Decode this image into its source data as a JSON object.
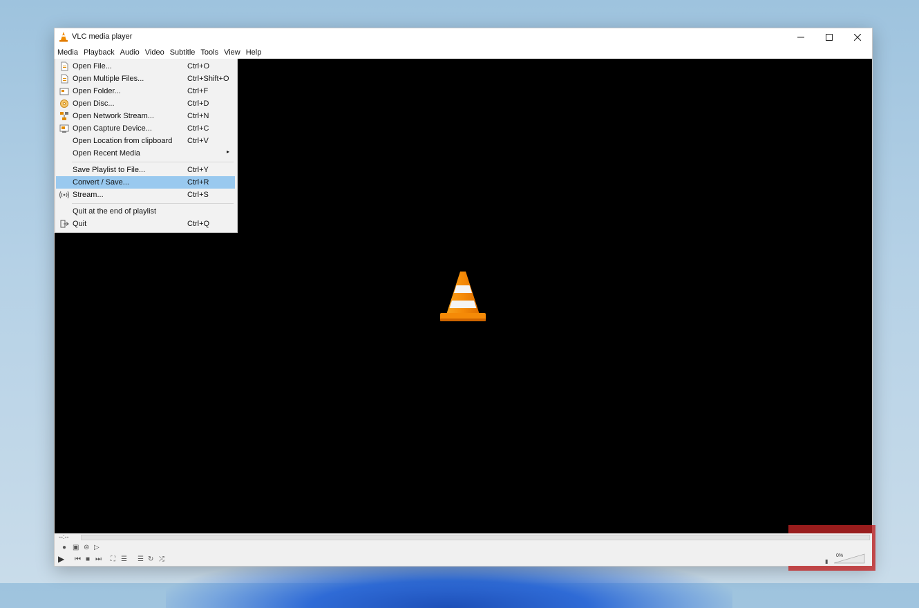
{
  "window": {
    "title": "VLC media player"
  },
  "menubar": [
    "Media",
    "Playback",
    "Audio",
    "Video",
    "Subtitle",
    "Tools",
    "View",
    "Help"
  ],
  "media_menu": {
    "items": [
      {
        "label": "Open File...",
        "shortcut": "Ctrl+O",
        "icon": "file-icon"
      },
      {
        "label": "Open Multiple Files...",
        "shortcut": "Ctrl+Shift+O",
        "icon": "multiple-files-icon"
      },
      {
        "label": "Open Folder...",
        "shortcut": "Ctrl+F",
        "icon": "folder-icon"
      },
      {
        "label": "Open Disc...",
        "shortcut": "Ctrl+D",
        "icon": "disc-icon"
      },
      {
        "label": "Open Network Stream...",
        "shortcut": "Ctrl+N",
        "icon": "network-icon"
      },
      {
        "label": "Open Capture Device...",
        "shortcut": "Ctrl+C",
        "icon": "capture-device-icon"
      },
      {
        "label": "Open Location from clipboard",
        "shortcut": "Ctrl+V",
        "icon": ""
      },
      {
        "label": "Open Recent Media",
        "shortcut": "",
        "icon": "",
        "submenu": true
      },
      {
        "label": "Save Playlist to File...",
        "shortcut": "Ctrl+Y",
        "icon": ""
      },
      {
        "label": "Convert / Save...",
        "shortcut": "Ctrl+R",
        "icon": "",
        "highlighted": true
      },
      {
        "label": "Stream...",
        "shortcut": "Ctrl+S",
        "icon": "stream-icon"
      },
      {
        "label": "Quit at the end of playlist",
        "shortcut": "",
        "icon": ""
      },
      {
        "label": "Quit",
        "shortcut": "Ctrl+Q",
        "icon": "quit-icon"
      }
    ]
  },
  "controls": {
    "time": "--:--",
    "volume": "0%"
  },
  "colors": {
    "highlight": "#99c9ef",
    "cone_orange": "#f08c00",
    "watermark": "#c42424"
  }
}
